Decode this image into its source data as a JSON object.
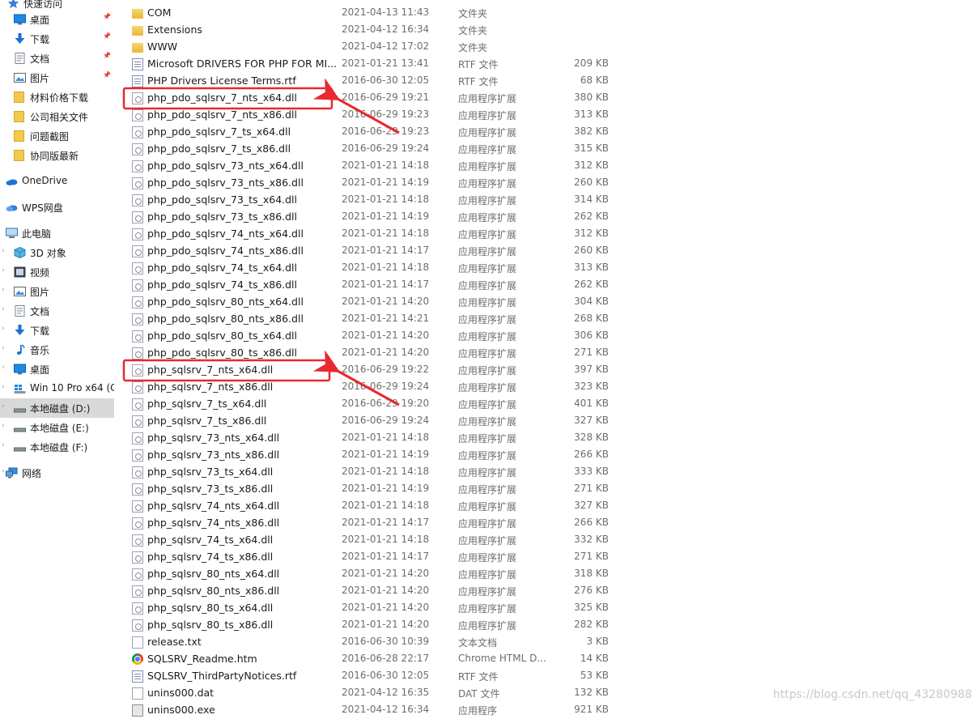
{
  "sidebar": {
    "items": [
      {
        "label": "快速访问",
        "icon": "star-icon",
        "pinned": false
      },
      {
        "label": "桌面",
        "icon": "desktop-icon",
        "pinned": true
      },
      {
        "label": "下载",
        "icon": "download-icon",
        "pinned": true
      },
      {
        "label": "文档",
        "icon": "document-icon",
        "pinned": true
      },
      {
        "label": "图片",
        "icon": "pictures-icon",
        "pinned": true
      },
      {
        "label": "材料价格下载",
        "icon": "folder-icon",
        "pinned": false
      },
      {
        "label": "公司相关文件",
        "icon": "folder-icon",
        "pinned": false
      },
      {
        "label": "问题截图",
        "icon": "folder-icon",
        "pinned": false
      },
      {
        "label": "协同版最新",
        "icon": "folder-icon",
        "pinned": false
      },
      {
        "label": "OneDrive",
        "icon": "onedrive-icon",
        "pinned": false
      },
      {
        "label": "WPS网盘",
        "icon": "wps-cloud-icon",
        "pinned": false
      },
      {
        "label": "此电脑",
        "icon": "computer-icon",
        "pinned": false
      },
      {
        "label": "3D 对象",
        "icon": "3d-objects-icon",
        "pinned": false
      },
      {
        "label": "视频",
        "icon": "video-icon",
        "pinned": false
      },
      {
        "label": "图片",
        "icon": "pictures-icon",
        "pinned": false
      },
      {
        "label": "文档",
        "icon": "document-icon",
        "pinned": false
      },
      {
        "label": "下载",
        "icon": "download-icon",
        "pinned": false
      },
      {
        "label": "音乐",
        "icon": "music-icon",
        "pinned": false
      },
      {
        "label": "桌面",
        "icon": "desktop-icon",
        "pinned": false
      },
      {
        "label": "Win 10 Pro x64 (C",
        "icon": "windows-drive-icon",
        "pinned": false
      },
      {
        "label": "本地磁盘 (D:)",
        "icon": "drive-icon",
        "pinned": false,
        "selected": true
      },
      {
        "label": "本地磁盘 (E:)",
        "icon": "drive-icon",
        "pinned": false
      },
      {
        "label": "本地磁盘 (F:)",
        "icon": "drive-icon",
        "pinned": false
      },
      {
        "label": "网络",
        "icon": "network-icon",
        "pinned": false
      }
    ]
  },
  "files": [
    {
      "name": "COM",
      "date": "2021-04-13 11:43",
      "type": "文件夹",
      "size": "",
      "icon": "folder"
    },
    {
      "name": "Extensions",
      "date": "2021-04-12 16:34",
      "type": "文件夹",
      "size": "",
      "icon": "folder"
    },
    {
      "name": "WWW",
      "date": "2021-04-12 17:02",
      "type": "文件夹",
      "size": "",
      "icon": "folder"
    },
    {
      "name": "Microsoft DRIVERS FOR PHP FOR MI...",
      "date": "2021-01-21 13:41",
      "type": "RTF 文件",
      "size": "209 KB",
      "icon": "rtf"
    },
    {
      "name": "PHP Drivers License Terms.rtf",
      "date": "2016-06-30 12:05",
      "type": "RTF 文件",
      "size": "68 KB",
      "icon": "rtf"
    },
    {
      "name": "php_pdo_sqlsrv_7_nts_x64.dll",
      "date": "2016-06-29 19:21",
      "type": "应用程序扩展",
      "size": "380 KB",
      "icon": "dll"
    },
    {
      "name": "php_pdo_sqlsrv_7_nts_x86.dll",
      "date": "2016-06-29 19:23",
      "type": "应用程序扩展",
      "size": "313 KB",
      "icon": "dll"
    },
    {
      "name": "php_pdo_sqlsrv_7_ts_x64.dll",
      "date": "2016-06-29 19:23",
      "type": "应用程序扩展",
      "size": "382 KB",
      "icon": "dll"
    },
    {
      "name": "php_pdo_sqlsrv_7_ts_x86.dll",
      "date": "2016-06-29 19:24",
      "type": "应用程序扩展",
      "size": "315 KB",
      "icon": "dll"
    },
    {
      "name": "php_pdo_sqlsrv_73_nts_x64.dll",
      "date": "2021-01-21 14:18",
      "type": "应用程序扩展",
      "size": "312 KB",
      "icon": "dll"
    },
    {
      "name": "php_pdo_sqlsrv_73_nts_x86.dll",
      "date": "2021-01-21 14:19",
      "type": "应用程序扩展",
      "size": "260 KB",
      "icon": "dll"
    },
    {
      "name": "php_pdo_sqlsrv_73_ts_x64.dll",
      "date": "2021-01-21 14:18",
      "type": "应用程序扩展",
      "size": "314 KB",
      "icon": "dll"
    },
    {
      "name": "php_pdo_sqlsrv_73_ts_x86.dll",
      "date": "2021-01-21 14:19",
      "type": "应用程序扩展",
      "size": "262 KB",
      "icon": "dll"
    },
    {
      "name": "php_pdo_sqlsrv_74_nts_x64.dll",
      "date": "2021-01-21 14:18",
      "type": "应用程序扩展",
      "size": "312 KB",
      "icon": "dll"
    },
    {
      "name": "php_pdo_sqlsrv_74_nts_x86.dll",
      "date": "2021-01-21 14:17",
      "type": "应用程序扩展",
      "size": "260 KB",
      "icon": "dll"
    },
    {
      "name": "php_pdo_sqlsrv_74_ts_x64.dll",
      "date": "2021-01-21 14:18",
      "type": "应用程序扩展",
      "size": "313 KB",
      "icon": "dll"
    },
    {
      "name": "php_pdo_sqlsrv_74_ts_x86.dll",
      "date": "2021-01-21 14:17",
      "type": "应用程序扩展",
      "size": "262 KB",
      "icon": "dll"
    },
    {
      "name": "php_pdo_sqlsrv_80_nts_x64.dll",
      "date": "2021-01-21 14:20",
      "type": "应用程序扩展",
      "size": "304 KB",
      "icon": "dll"
    },
    {
      "name": "php_pdo_sqlsrv_80_nts_x86.dll",
      "date": "2021-01-21 14:21",
      "type": "应用程序扩展",
      "size": "268 KB",
      "icon": "dll"
    },
    {
      "name": "php_pdo_sqlsrv_80_ts_x64.dll",
      "date": "2021-01-21 14:20",
      "type": "应用程序扩展",
      "size": "306 KB",
      "icon": "dll"
    },
    {
      "name": "php_pdo_sqlsrv_80_ts_x86.dll",
      "date": "2021-01-21 14:20",
      "type": "应用程序扩展",
      "size": "271 KB",
      "icon": "dll"
    },
    {
      "name": "php_sqlsrv_7_nts_x64.dll",
      "date": "2016-06-29 19:22",
      "type": "应用程序扩展",
      "size": "397 KB",
      "icon": "dll"
    },
    {
      "name": "php_sqlsrv_7_nts_x86.dll",
      "date": "2016-06-29 19:24",
      "type": "应用程序扩展",
      "size": "323 KB",
      "icon": "dll"
    },
    {
      "name": "php_sqlsrv_7_ts_x64.dll",
      "date": "2016-06-29 19:20",
      "type": "应用程序扩展",
      "size": "401 KB",
      "icon": "dll"
    },
    {
      "name": "php_sqlsrv_7_ts_x86.dll",
      "date": "2016-06-29 19:24",
      "type": "应用程序扩展",
      "size": "327 KB",
      "icon": "dll"
    },
    {
      "name": "php_sqlsrv_73_nts_x64.dll",
      "date": "2021-01-21 14:18",
      "type": "应用程序扩展",
      "size": "328 KB",
      "icon": "dll"
    },
    {
      "name": "php_sqlsrv_73_nts_x86.dll",
      "date": "2021-01-21 14:19",
      "type": "应用程序扩展",
      "size": "266 KB",
      "icon": "dll"
    },
    {
      "name": "php_sqlsrv_73_ts_x64.dll",
      "date": "2021-01-21 14:18",
      "type": "应用程序扩展",
      "size": "333 KB",
      "icon": "dll"
    },
    {
      "name": "php_sqlsrv_73_ts_x86.dll",
      "date": "2021-01-21 14:19",
      "type": "应用程序扩展",
      "size": "271 KB",
      "icon": "dll"
    },
    {
      "name": "php_sqlsrv_74_nts_x64.dll",
      "date": "2021-01-21 14:18",
      "type": "应用程序扩展",
      "size": "327 KB",
      "icon": "dll"
    },
    {
      "name": "php_sqlsrv_74_nts_x86.dll",
      "date": "2021-01-21 14:17",
      "type": "应用程序扩展",
      "size": "266 KB",
      "icon": "dll"
    },
    {
      "name": "php_sqlsrv_74_ts_x64.dll",
      "date": "2021-01-21 14:18",
      "type": "应用程序扩展",
      "size": "332 KB",
      "icon": "dll"
    },
    {
      "name": "php_sqlsrv_74_ts_x86.dll",
      "date": "2021-01-21 14:17",
      "type": "应用程序扩展",
      "size": "271 KB",
      "icon": "dll"
    },
    {
      "name": "php_sqlsrv_80_nts_x64.dll",
      "date": "2021-01-21 14:20",
      "type": "应用程序扩展",
      "size": "318 KB",
      "icon": "dll"
    },
    {
      "name": "php_sqlsrv_80_nts_x86.dll",
      "date": "2021-01-21 14:20",
      "type": "应用程序扩展",
      "size": "276 KB",
      "icon": "dll"
    },
    {
      "name": "php_sqlsrv_80_ts_x64.dll",
      "date": "2021-01-21 14:20",
      "type": "应用程序扩展",
      "size": "325 KB",
      "icon": "dll"
    },
    {
      "name": "php_sqlsrv_80_ts_x86.dll",
      "date": "2021-01-21 14:20",
      "type": "应用程序扩展",
      "size": "282 KB",
      "icon": "dll"
    },
    {
      "name": "release.txt",
      "date": "2016-06-30 10:39",
      "type": "文本文档",
      "size": "3 KB",
      "icon": "file"
    },
    {
      "name": "SQLSRV_Readme.htm",
      "date": "2016-06-28 22:17",
      "type": "Chrome HTML D...",
      "size": "14 KB",
      "icon": "chrome"
    },
    {
      "name": "SQLSRV_ThirdPartyNotices.rtf",
      "date": "2016-06-30 12:05",
      "type": "RTF 文件",
      "size": "53 KB",
      "icon": "rtf"
    },
    {
      "name": "unins000.dat",
      "date": "2021-04-12 16:35",
      "type": "DAT 文件",
      "size": "132 KB",
      "icon": "file"
    },
    {
      "name": "unins000.exe",
      "date": "2021-04-12 16:34",
      "type": "应用程序",
      "size": "921 KB",
      "icon": "exe"
    }
  ],
  "annotations": {
    "highlight_rows": [
      5,
      21
    ],
    "box_color": "#e8292f"
  },
  "watermark": "https://blog.csdn.net/qq_43280988"
}
